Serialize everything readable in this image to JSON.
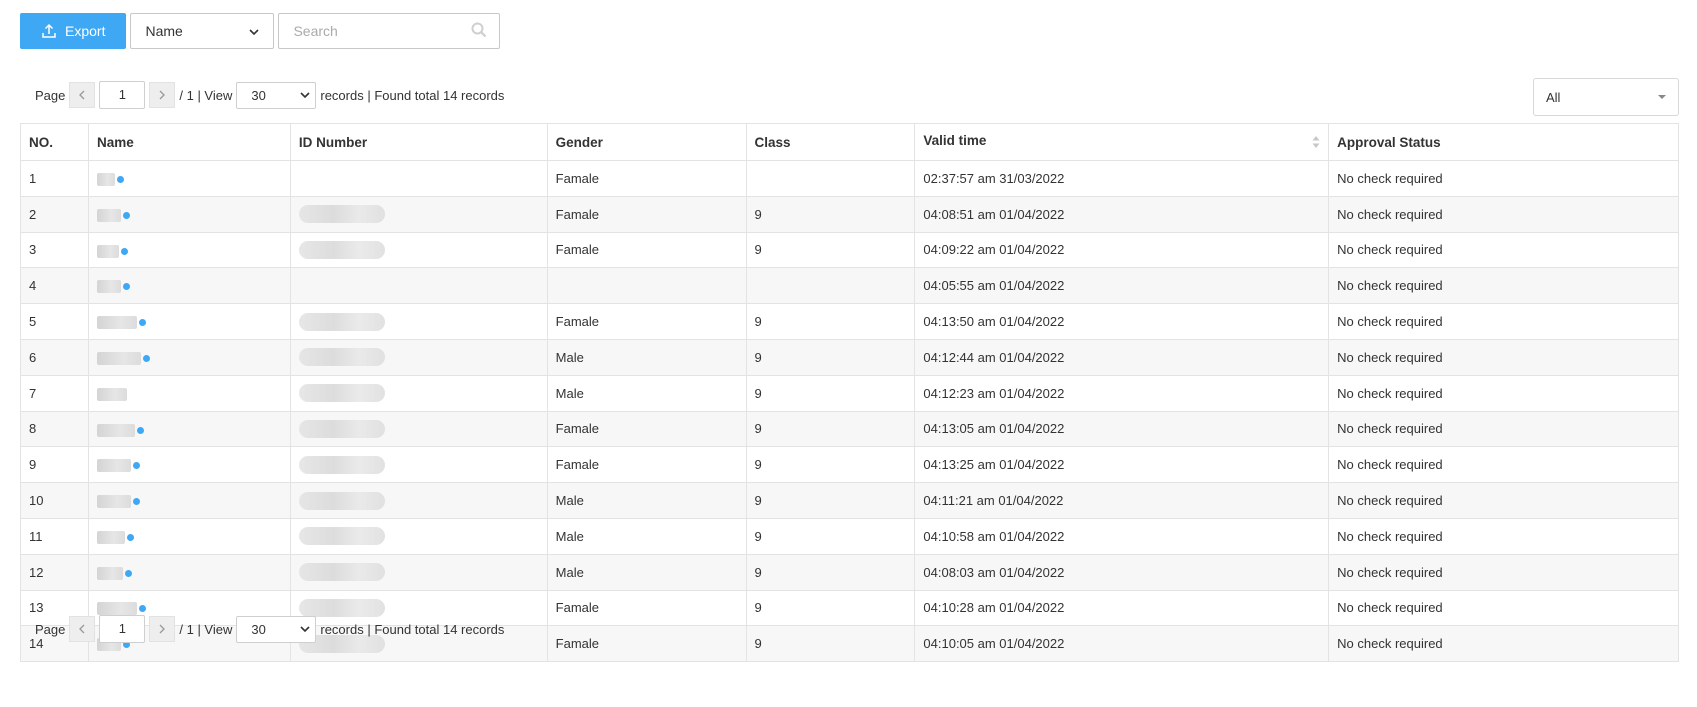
{
  "toolbar": {
    "export_label": "Export",
    "field_select_value": "Name",
    "search_placeholder": "Search"
  },
  "pager": {
    "page_label": "Page",
    "current_page": "1",
    "total_pages_text": "/ 1 | View",
    "per_page": "30",
    "records_text": "records | Found total 14 records"
  },
  "filter": {
    "value": "All"
  },
  "table": {
    "columns": [
      "NO.",
      "Name",
      "ID Number",
      "Gender",
      "Class",
      "Valid time",
      "Approval Status"
    ],
    "rows": [
      {
        "no": "1",
        "gender": "Famale",
        "class": "",
        "valid": "02:37:57 am 31/03/2022",
        "status": "No check required"
      },
      {
        "no": "2",
        "gender": "Famale",
        "class": "9",
        "valid": "04:08:51 am 01/04/2022",
        "status": "No check required"
      },
      {
        "no": "3",
        "gender": "Famale",
        "class": "9",
        "valid": "04:09:22 am 01/04/2022",
        "status": "No check required"
      },
      {
        "no": "4",
        "gender": "",
        "class": "",
        "valid": "04:05:55 am 01/04/2022",
        "status": "No check required"
      },
      {
        "no": "5",
        "gender": "Famale",
        "class": "9",
        "valid": "04:13:50 am 01/04/2022",
        "status": "No check required"
      },
      {
        "no": "6",
        "gender": "Male",
        "class": "9",
        "valid": "04:12:44 am 01/04/2022",
        "status": "No check required"
      },
      {
        "no": "7",
        "gender": "Male",
        "class": "9",
        "valid": "04:12:23 am 01/04/2022",
        "status": "No check required"
      },
      {
        "no": "8",
        "gender": "Famale",
        "class": "9",
        "valid": "04:13:05 am 01/04/2022",
        "status": "No check required"
      },
      {
        "no": "9",
        "gender": "Famale",
        "class": "9",
        "valid": "04:13:25 am 01/04/2022",
        "status": "No check required"
      },
      {
        "no": "10",
        "gender": "Male",
        "class": "9",
        "valid": "04:11:21 am 01/04/2022",
        "status": "No check required"
      },
      {
        "no": "11",
        "gender": "Male",
        "class": "9",
        "valid": "04:10:58 am 01/04/2022",
        "status": "No check required"
      },
      {
        "no": "12",
        "gender": "Male",
        "class": "9",
        "valid": "04:08:03 am 01/04/2022",
        "status": "No check required"
      },
      {
        "no": "13",
        "gender": "Famale",
        "class": "9",
        "valid": "04:10:28 am 01/04/2022",
        "status": "No check required"
      },
      {
        "no": "14",
        "gender": "Famale",
        "class": "9",
        "valid": "04:10:05 am 01/04/2022",
        "status": "No check required"
      }
    ]
  },
  "colors": {
    "accent": "#3ea8f5"
  }
}
